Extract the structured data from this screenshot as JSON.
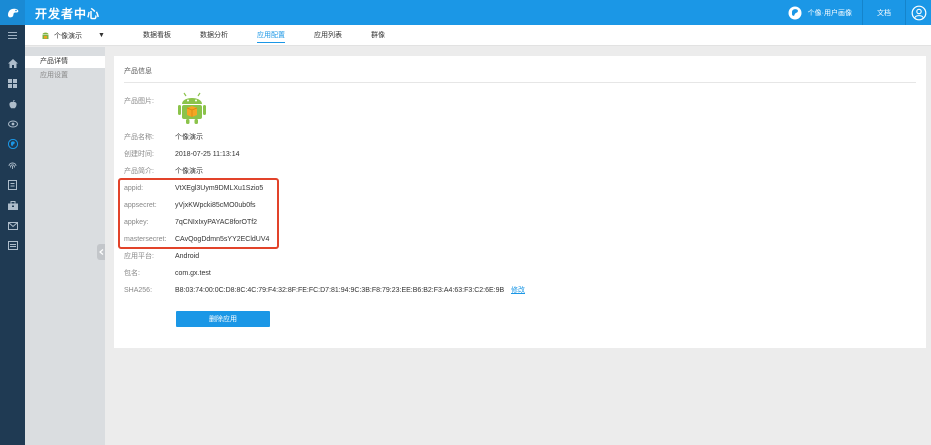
{
  "header": {
    "title": "开发者中心",
    "user_label": "个像·用户画像",
    "doc_link": "文档",
    "icons": [
      "bird-logo-icon",
      "user-avatar-icon",
      "account-icon"
    ]
  },
  "rail": {
    "icons": [
      "menu-icon",
      "home-icon",
      "grid-icon",
      "apple-icon",
      "eye-icon",
      "profile-icon",
      "fingerprint-icon",
      "document-icon",
      "toolbox-icon",
      "mail-icon",
      "card-icon"
    ]
  },
  "subnav": {
    "app_name": "个像演示",
    "tabs": [
      {
        "label": "数据看板"
      },
      {
        "label": "数据分析"
      },
      {
        "label": "应用配置"
      },
      {
        "label": "应用列表"
      },
      {
        "label": "群像"
      }
    ],
    "active_tab": "应用配置"
  },
  "sidemenu": {
    "items": [
      {
        "label": "产品详情"
      },
      {
        "label": "应用设置"
      }
    ]
  },
  "product": {
    "section_title": "产品信息",
    "image_label": "产品图片:",
    "name_label": "产品名称:",
    "name_value": "个像演示",
    "created_label": "创建时间:",
    "created_value": "2018-07-25 11:13:14",
    "intro_label": "产品简介:",
    "intro_value": "个像演示",
    "appid_label": "appid:",
    "appid_value": "VtXEgl3Uym9DMLXu1Szio5",
    "appsecret_label": "appsecret:",
    "appsecret_value": "yVjxKWpcki85cMO0ub0fs",
    "appkey_label": "appkey:",
    "appkey_value": "7qCNIxIxyPAYAC8forOTf2",
    "mastersecret_label": "mastersecret:",
    "mastersecret_value": "CAvQogDdmn5sYY2ECldUV4",
    "platform_label": "应用平台:",
    "platform_value": "Android",
    "package_label": "包名:",
    "package_value": "com.gx.test",
    "sha_label": "SHA256:",
    "sha_value": "B8:03:74:00:0C:D8:8C:4C:79:F4:32:8F:FE:FC:D7:81:94:9C:3B:F8:79:23:EE:B6:B2:F3:A4:63:F3:C2:6E:9B",
    "modify_link": "修改",
    "delete_button": "删除应用"
  },
  "colors": {
    "primary": "#1b97e6",
    "rail": "#1f3a53",
    "highlight": "#e2432a"
  }
}
